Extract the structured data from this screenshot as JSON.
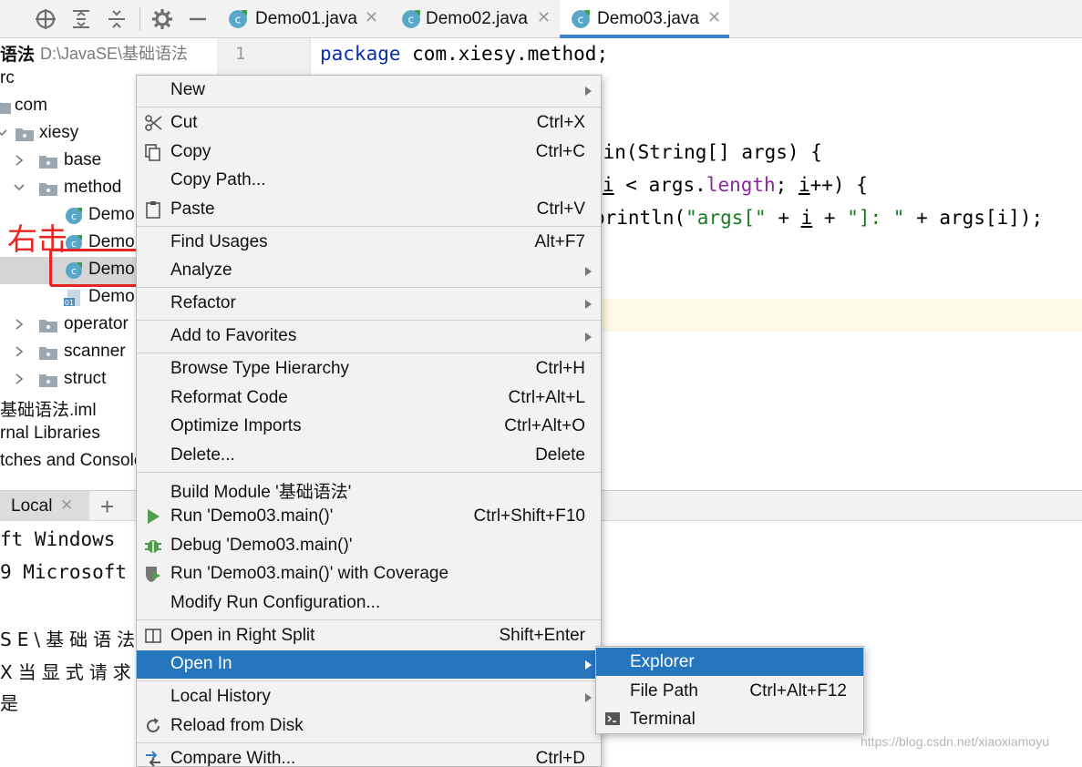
{
  "project_toolbar": {
    "icons": [
      "crosshair-icon",
      "expand-all-icon",
      "collapse-all-icon",
      "gear-icon",
      "minimize-icon"
    ]
  },
  "project_tree": {
    "root_label": "语法",
    "root_path": "D:\\JavaSE\\基础语法",
    "items": [
      {
        "label": "rc",
        "kind": "folder"
      },
      {
        "label": "com",
        "kind": "package"
      },
      {
        "label": "xiesy",
        "kind": "package"
      },
      {
        "label": "base",
        "kind": "package"
      },
      {
        "label": "method",
        "kind": "package"
      },
      {
        "label": "Demo",
        "kind": "class"
      },
      {
        "label": "Demo",
        "kind": "class"
      },
      {
        "label": "Demo",
        "kind": "class",
        "selected": true
      },
      {
        "label": "Demo",
        "kind": "class-file"
      },
      {
        "label": "operator",
        "kind": "package"
      },
      {
        "label": "scanner",
        "kind": "package"
      },
      {
        "label": "struct",
        "kind": "package"
      },
      {
        "label": "基础语法.iml",
        "kind": "file"
      },
      {
        "label": "rnal Libraries",
        "kind": "library"
      },
      {
        "label": "tches and Console",
        "kind": "scratch"
      }
    ]
  },
  "annotation": {
    "label": "右击",
    "color": "#e52521"
  },
  "editor": {
    "tabs": [
      {
        "label": "Demo01.java",
        "active": false
      },
      {
        "label": "Demo02.java",
        "active": false
      },
      {
        "label": "Demo03.java",
        "active": true
      }
    ],
    "line_number": "1",
    "code": {
      "line1_kw": "package",
      "line1_rest": " com.xiesy.method;",
      "line2": "ain(String[] args) {",
      "line3_i1": "i",
      "line3_mid": " < args.",
      "line3_field": "length",
      "line3_semi": "; ",
      "line3_i2": "i",
      "line3_end": "++) {",
      "line4_a": "println(",
      "line4_s1": "\"args[\"",
      "line4_b": " + ",
      "line4_i": "i",
      "line4_c": " + ",
      "line4_s2": "\"]: \"",
      "line4_d": " + args[i]);"
    }
  },
  "terminal": {
    "tab_label": "Local",
    "add_label": "+",
    "lines": [
      "ft Windows",
      "9 Microsoft",
      "SE\\基础语法",
      "X当显式请求",
      "是"
    ]
  },
  "context_menu": {
    "items": [
      {
        "label": "New",
        "shortcut": "",
        "submenu": true,
        "icon": ""
      },
      {
        "label": "Cut",
        "shortcut": "Ctrl+X",
        "submenu": false,
        "icon": "scissors-icon"
      },
      {
        "label": "Copy",
        "shortcut": "Ctrl+C",
        "submenu": false,
        "icon": "copy-icon"
      },
      {
        "label": "Copy Path...",
        "shortcut": "",
        "submenu": false,
        "icon": ""
      },
      {
        "label": "Paste",
        "shortcut": "Ctrl+V",
        "submenu": false,
        "icon": "paste-icon"
      },
      {
        "label": "Find Usages",
        "shortcut": "Alt+F7",
        "submenu": false,
        "icon": ""
      },
      {
        "label": "Analyze",
        "shortcut": "",
        "submenu": true,
        "icon": ""
      },
      {
        "label": "Refactor",
        "shortcut": "",
        "submenu": true,
        "icon": ""
      },
      {
        "label": "Add to Favorites",
        "shortcut": "",
        "submenu": true,
        "icon": ""
      },
      {
        "label": "Browse Type Hierarchy",
        "shortcut": "Ctrl+H",
        "submenu": false,
        "icon": ""
      },
      {
        "label": "Reformat Code",
        "shortcut": "Ctrl+Alt+L",
        "submenu": false,
        "icon": ""
      },
      {
        "label": "Optimize Imports",
        "shortcut": "Ctrl+Alt+O",
        "submenu": false,
        "icon": ""
      },
      {
        "label": "Delete...",
        "shortcut": "Delete",
        "submenu": false,
        "icon": ""
      },
      {
        "label": "Build Module '基础语法'",
        "shortcut": "",
        "submenu": false,
        "icon": ""
      },
      {
        "label": "Run 'Demo03.main()'",
        "shortcut": "Ctrl+Shift+F10",
        "submenu": false,
        "icon": "run-icon"
      },
      {
        "label": "Debug 'Demo03.main()'",
        "shortcut": "",
        "submenu": false,
        "icon": "debug-icon"
      },
      {
        "label": "Run 'Demo03.main()' with Coverage",
        "shortcut": "",
        "submenu": false,
        "icon": "coverage-icon"
      },
      {
        "label": "Modify Run Configuration...",
        "shortcut": "",
        "submenu": false,
        "icon": ""
      },
      {
        "label": "Open in Right Split",
        "shortcut": "Shift+Enter",
        "submenu": false,
        "icon": "split-icon"
      },
      {
        "label": "Open In",
        "shortcut": "",
        "submenu": true,
        "icon": "",
        "highlighted": true
      },
      {
        "label": "Local History",
        "shortcut": "",
        "submenu": true,
        "icon": ""
      },
      {
        "label": "Reload from Disk",
        "shortcut": "",
        "submenu": false,
        "icon": "reload-icon"
      },
      {
        "label": "Compare With...",
        "shortcut": "Ctrl+D",
        "submenu": false,
        "icon": "compare-icon"
      }
    ]
  },
  "submenu": {
    "items": [
      {
        "label": "Explorer",
        "shortcut": "",
        "highlighted": true
      },
      {
        "label": "File Path",
        "shortcut": "Ctrl+Alt+F12"
      },
      {
        "label": "Terminal",
        "shortcut": "",
        "icon": "terminal-icon"
      }
    ]
  },
  "watermark": "https://blog.csdn.net/xiaoxiamoyu",
  "colors": {
    "menu_highlight": "#2675bf",
    "keyword": "#0b2fa4",
    "string": "#167c23",
    "field": "#8a2a9a",
    "tab_underline": "#4083c9",
    "annotation_red": "#e52521"
  }
}
